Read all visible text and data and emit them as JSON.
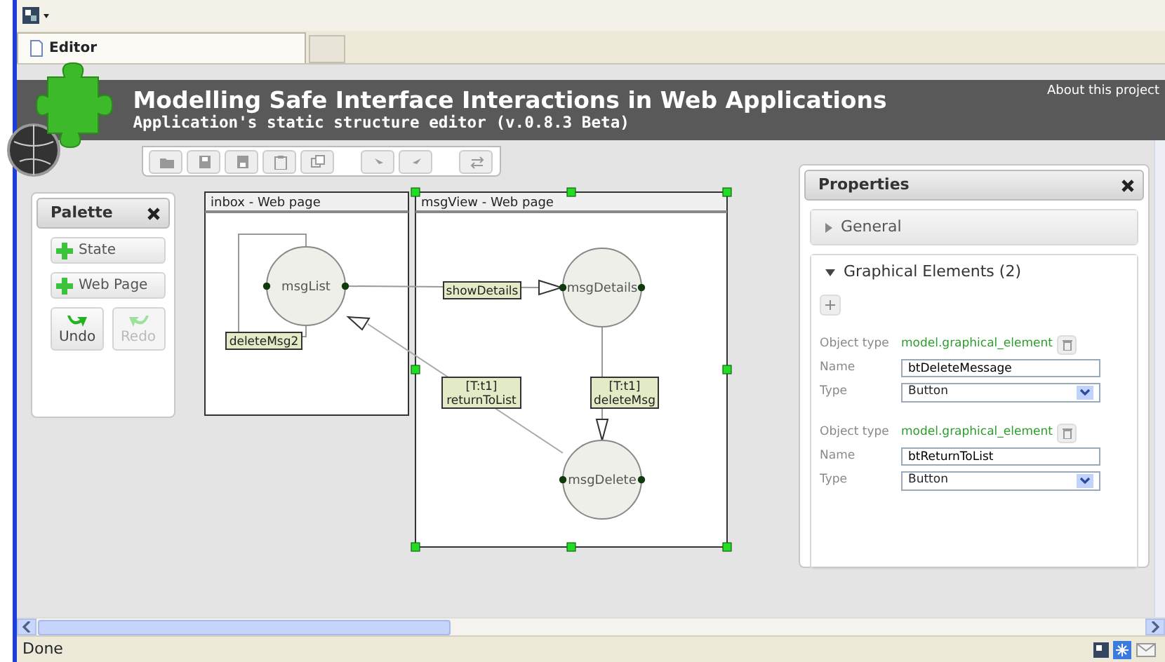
{
  "browser": {
    "tabs": [
      {
        "label": "Editor",
        "selected": true
      }
    ],
    "status": "Done"
  },
  "header": {
    "title": "Modelling Safe Interface Interactions in Web Applications",
    "subtitle": "Application's static structure editor (v.0.8.3 Beta)",
    "about_link": "About this project"
  },
  "palette": {
    "title": "Palette",
    "items": [
      {
        "kind": "add",
        "label": "State",
        "disabled": false
      },
      {
        "kind": "add",
        "label": "Web Page",
        "disabled": false
      },
      {
        "kind": "undo",
        "label": "Undo",
        "disabled": false
      },
      {
        "kind": "redo",
        "label": "Redo",
        "disabled": true
      }
    ]
  },
  "diagram": {
    "pages": [
      {
        "title": "inbox - Web page",
        "selected": false
      },
      {
        "title": "msgView - Web page",
        "selected": true
      }
    ],
    "states": [
      {
        "label": "msgList"
      },
      {
        "label": "msgDetails"
      },
      {
        "label": "msgDelete"
      }
    ],
    "transitions": [
      {
        "kind": "straight",
        "label": "showDetails"
      },
      {
        "kind": "loop",
        "label": "deleteMsg2"
      },
      {
        "kind": "diagonal",
        "guard": "[T:t1]",
        "label": "returnToList"
      },
      {
        "kind": "vertical",
        "guard": "[T:t1]",
        "label": "deleteMsg"
      }
    ]
  },
  "properties": {
    "title": "Properties",
    "sections": [
      {
        "title": "General",
        "expanded": false
      },
      {
        "title": "Graphical Elements (2)",
        "expanded": true,
        "elements": [
          {
            "object_type_label": "Object type",
            "object_type": "model.graphical_element",
            "name_label": "Name",
            "name": "btDeleteMessage",
            "type_label": "Type",
            "type": "Button"
          },
          {
            "object_type_label": "Object type",
            "object_type": "model.graphical_element",
            "name_label": "Name",
            "name": "btReturnToList",
            "type_label": "Type",
            "type": "Button"
          }
        ]
      }
    ]
  }
}
